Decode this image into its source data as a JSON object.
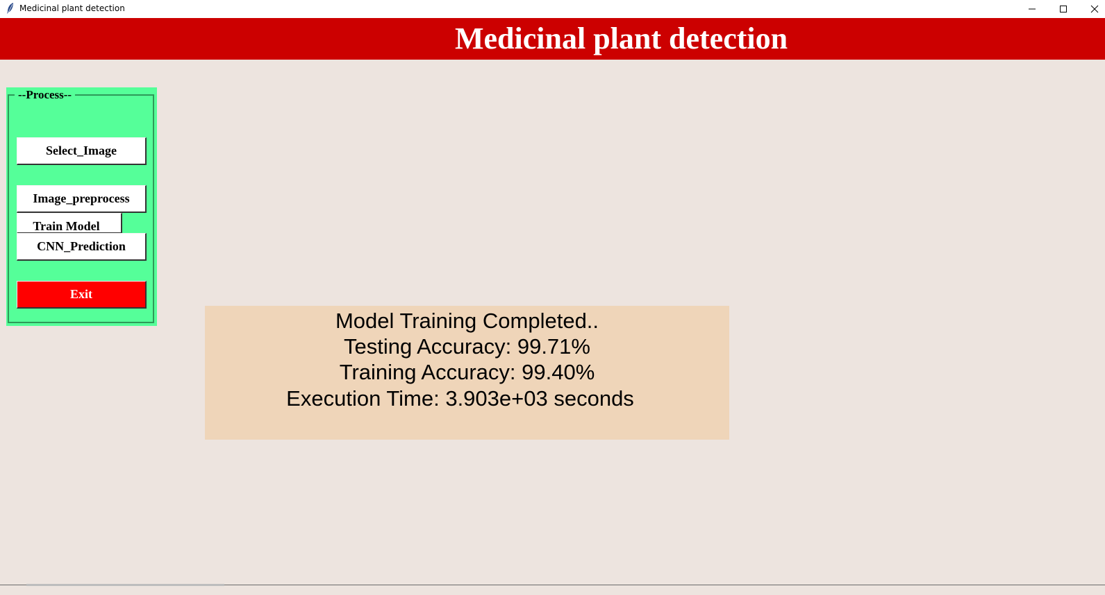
{
  "window": {
    "title": "Medicinal plant detection",
    "icon": "feather-icon"
  },
  "banner": {
    "title": "Medicinal plant detection",
    "color": "#cc0000"
  },
  "panel": {
    "legend": "--Process--",
    "color": "#55ff99",
    "buttons": {
      "select_image": "Select_Image",
      "image_preprocess": "Image_preprocess",
      "train_model": "Train Model",
      "cnn_prediction": "CNN_Prediction",
      "exit": "Exit"
    },
    "exit_color": "#ff0000"
  },
  "result": {
    "lines": [
      "Model Training Completed..",
      "Testing Accuracy: 99.71%",
      "Training Accuracy: 99.40%",
      "Execution Time: 3.903e+03 seconds"
    ],
    "background": "#efd5b9"
  }
}
